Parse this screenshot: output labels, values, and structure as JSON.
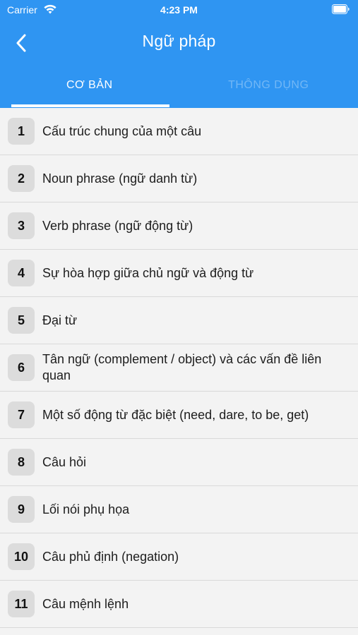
{
  "status_bar": {
    "carrier": "Carrier",
    "time": "4:23 PM"
  },
  "header": {
    "title": "Ngữ pháp",
    "back_icon": "chevron-left-icon",
    "color": "#2f95f2"
  },
  "tabs": [
    {
      "label": "CƠ BẢN",
      "active": true
    },
    {
      "label": "THÔNG DỤNG",
      "active": false
    }
  ],
  "items": [
    {
      "number": "1",
      "label": "Cấu trúc chung của một câu"
    },
    {
      "number": "2",
      "label": "Noun phrase (ngữ danh từ)"
    },
    {
      "number": "3",
      "label": "Verb phrase (ngữ động từ)"
    },
    {
      "number": "4",
      "label": "Sự hòa hợp giữa chủ ngữ và động từ"
    },
    {
      "number": "5",
      "label": "Đại từ"
    },
    {
      "number": "6",
      "label": "Tân ngữ (complement / object) và các vấn đề liên quan"
    },
    {
      "number": "7",
      "label": "Một số động từ đặc biệt (need, dare, to be, get)"
    },
    {
      "number": "8",
      "label": "Câu hỏi"
    },
    {
      "number": "9",
      "label": "Lối nói phụ họa"
    },
    {
      "number": "10",
      "label": "Câu phủ định (negation)"
    },
    {
      "number": "11",
      "label": "Câu mệnh lệnh"
    }
  ]
}
